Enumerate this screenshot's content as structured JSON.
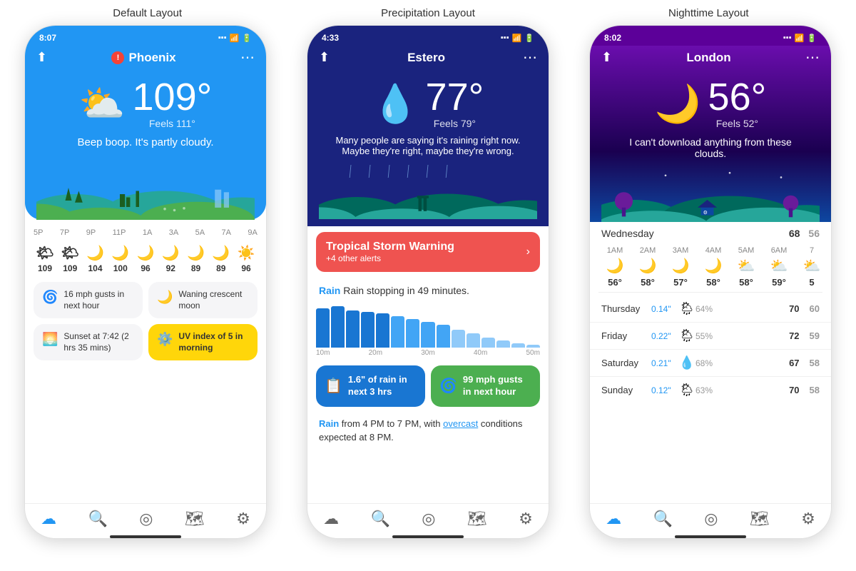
{
  "labels": {
    "default": "Default Layout",
    "precipitation": "Precipitation Layout",
    "nighttime": "Nighttime Layout"
  },
  "phone1": {
    "status_time": "8:07",
    "city": "Phoenix",
    "temp": "109°",
    "feels": "Feels 111°",
    "desc": "Beep boop. It's partly cloudy.",
    "hours": [
      "5P",
      "7P",
      "9P",
      "11P",
      "1A",
      "3A",
      "5A",
      "7A",
      "9A"
    ],
    "hourly_temps": [
      "109",
      "109",
      "104",
      "100",
      "96",
      "92",
      "89",
      "89",
      "96"
    ],
    "card1_text": "16 mph gusts in next hour",
    "card2_text": "Waning crescent moon",
    "card3_text": "Sunset at 7:42 (2 hrs 35 mins)",
    "card4_text": "UV index of 5 in morning"
  },
  "phone2": {
    "status_time": "4:33",
    "city": "Estero",
    "temp": "77°",
    "feels": "Feels 79°",
    "desc": "Many people are saying it's raining right now. Maybe they're right, maybe they're wrong.",
    "alert_title": "Tropical Storm Warning",
    "alert_sub": "+4 other alerts",
    "rain_soon": "Rain stopping in 49 minutes.",
    "stat1": "1.6\" of rain in next 3 hrs",
    "stat2": "99 mph gusts in next hour",
    "rain_later": "Rain from 4 PM to 7 PM, with overcast conditions expected at 8 PM.",
    "chart_labels": [
      "10m",
      "20m",
      "30m",
      "40m",
      "50m"
    ]
  },
  "phone3": {
    "status_time": "8:02",
    "city": "London",
    "temp": "56°",
    "feels": "Feels 52°",
    "desc": "I can't download anything from these clouds.",
    "wed_high": "68",
    "wed_low": "56",
    "hours": [
      "1AM",
      "2AM",
      "3AM",
      "4AM",
      "5AM",
      "6AM",
      "7"
    ],
    "hour_temps": [
      "56°",
      "58°",
      "57°",
      "58°",
      "58°",
      "59°",
      "5"
    ],
    "forecast": [
      {
        "day": "Thursday",
        "precip": "0.14\"",
        "icon": "🌦",
        "pct": "64%",
        "high": "70",
        "low": "60"
      },
      {
        "day": "Friday",
        "precip": "0.22\"",
        "icon": "🌦",
        "pct": "55%",
        "high": "72",
        "low": "59"
      },
      {
        "day": "Saturday",
        "precip": "0.21\"",
        "icon": "💧",
        "pct": "68%",
        "high": "67",
        "low": "58"
      },
      {
        "day": "Sunday",
        "precip": "0.12\"",
        "icon": "🌦",
        "pct": "63%",
        "high": "70",
        "low": "58"
      }
    ]
  },
  "nav": {
    "cloud": "☁",
    "search": "🔍",
    "compass": "⊕",
    "map": "⊞",
    "settings": "⚙"
  }
}
